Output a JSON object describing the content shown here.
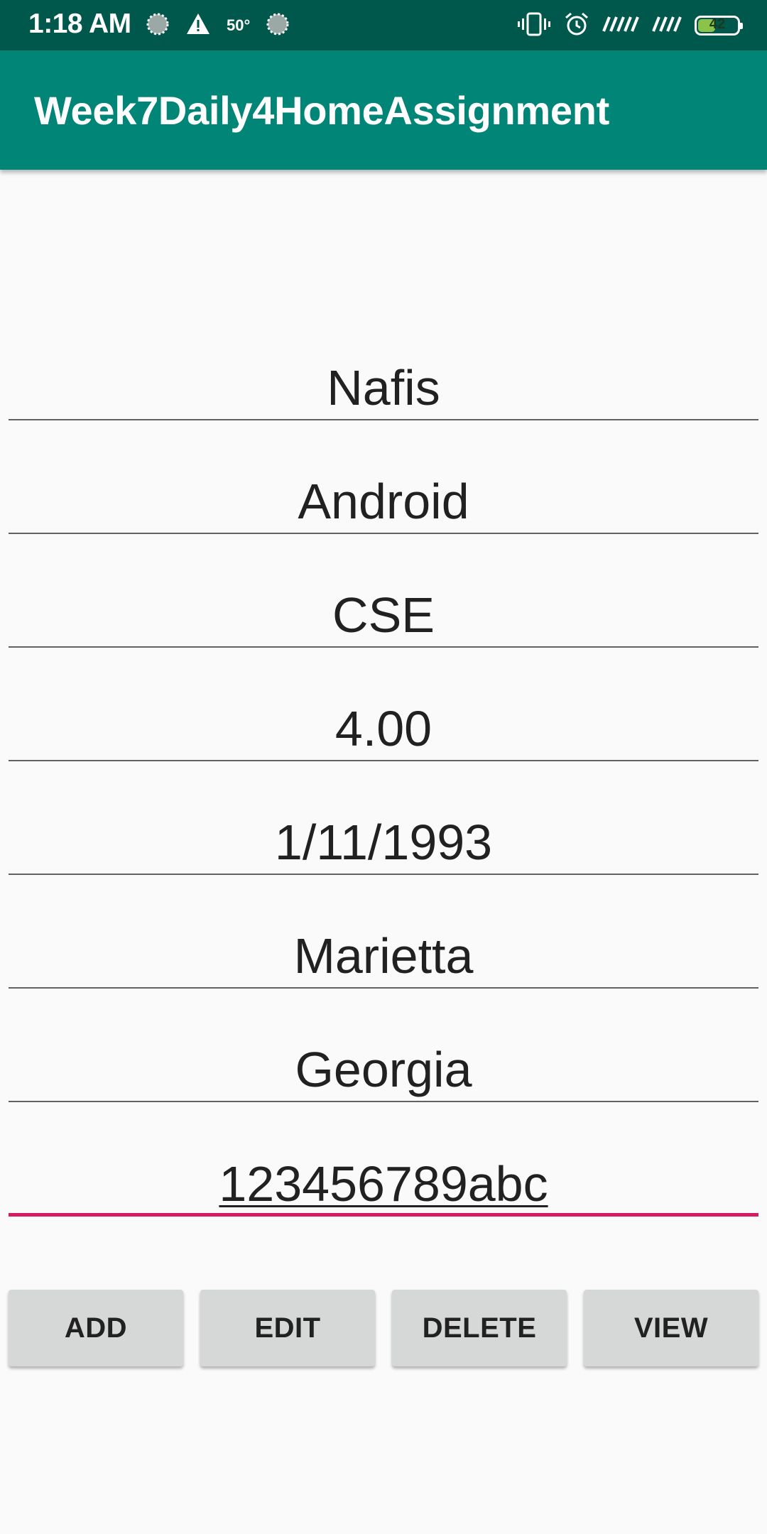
{
  "status_bar": {
    "time": "1:18 AM",
    "temperature": "50°",
    "battery_level": "42",
    "icons": [
      "spinner-icon",
      "warning-icon",
      "spinner-icon",
      "vibrate-icon",
      "alarm-icon",
      "signal-icon",
      "signal-icon",
      "battery-icon"
    ]
  },
  "app_bar": {
    "title": "Week7Daily4HomeAssignment"
  },
  "form": {
    "fields": [
      {
        "value": "Nafis"
      },
      {
        "value": "Android"
      },
      {
        "value": "CSE"
      },
      {
        "value": "4.00"
      },
      {
        "value": "1/11/1993"
      },
      {
        "value": "Marietta"
      },
      {
        "value": "Georgia"
      },
      {
        "value": "123456789abc"
      }
    ]
  },
  "buttons": {
    "add": "ADD",
    "edit": "EDIT",
    "delete": "DELETE",
    "view": "VIEW"
  },
  "colors": {
    "status_bar": "#00574b",
    "app_bar": "#008577",
    "accent": "#d81b60",
    "button": "#d6d7d7"
  }
}
